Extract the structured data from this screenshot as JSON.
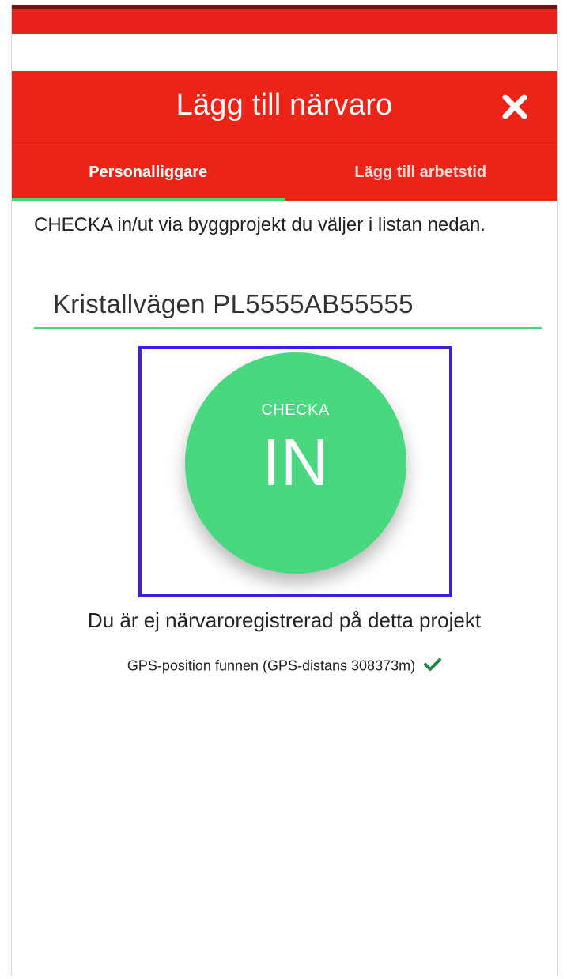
{
  "header": {
    "title": "Lägg till närvaro",
    "close_icon": "close-icon"
  },
  "tabs": [
    {
      "label": "Personalliggare",
      "active": true
    },
    {
      "label": "Lägg till arbetstid",
      "active": false
    }
  ],
  "content": {
    "instruction": "CHECKA in/ut via byggprojekt du väljer i listan nedan.",
    "selected_project": "Kristallvägen PL5555AB55555",
    "checkin_button": {
      "small_label": "CHECKA",
      "big_label": "IN"
    },
    "status_text": "Du är ej närvaroregistrerad på detta projekt",
    "gps_text": "GPS-position funnen (GPS-distans 308373m)",
    "gps_status_icon": "checkmark-icon"
  },
  "colors": {
    "header_red": "#ec2418",
    "accent_green": "#49d77f",
    "highlight_border": "#3b20e0",
    "check_green": "#1e8a3e"
  }
}
